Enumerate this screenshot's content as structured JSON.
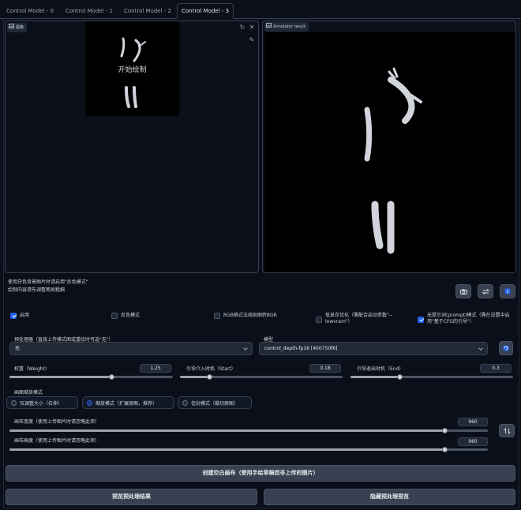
{
  "tabs": [
    {
      "label": "Control Model - 0"
    },
    {
      "label": "Control Model - 1"
    },
    {
      "label": "Control Model - 2"
    },
    {
      "label": "Control Model - 3"
    }
  ],
  "image_panel": {
    "label": "图像",
    "canvas_hint": "开始绘制"
  },
  "annotator": {
    "label": "Annotator result"
  },
  "notes": {
    "line1": "使用白色背景图片时请启用\"反色模式\"",
    "line2": "绘制内容请先调整笔刷粗细"
  },
  "checkboxes": {
    "enable": {
      "label": "启用",
      "checked": true
    },
    "invert": {
      "label": "反色模式",
      "checked": false
    },
    "rgb_bgr": {
      "label": "RGB格式法线贴图转BGR",
      "checked": false
    },
    "lowvram": {
      "label": "低显存优化（需配合启动参数\"--lowvram\"）",
      "checked": false
    },
    "guess_mode": {
      "label": "无提示词(prompt)模式（需在设置中启用\"基于CFG的引导\"）",
      "checked": true
    }
  },
  "preprocessor": {
    "label": "预处理器（直接上传模式图或重绘时可选\"无\"）",
    "value": "无"
  },
  "model": {
    "label": "模型",
    "value": "control_depth-fp16 [400750f6]"
  },
  "sliders": {
    "weight": {
      "label": "权重（Weight）",
      "value": "1.25",
      "fraction": 0.625
    },
    "start": {
      "label": "引导介入时机（Start）",
      "value": "0.18",
      "fraction": 0.18
    },
    "end": {
      "label": "引导退出时机（End）",
      "value": "0.3",
      "fraction": 0.3
    },
    "canvas_width": {
      "label": "画布宽度（使用上传图片时请忽略此项）",
      "value": "960",
      "fraction": 0.91
    },
    "canvas_height": {
      "label": "画布高度（使用上传图片时请忽略此项）",
      "value": "960",
      "fraction": 0.91
    }
  },
  "resize_mode": {
    "label": "画面缩放模式",
    "options": [
      {
        "label": "仅调整大小（拉伸）",
        "selected": false
      },
      {
        "label": "缩放模式（扩展原图，推荐）",
        "selected": true
      },
      {
        "label": "信封模式（裁切原图）",
        "selected": false
      }
    ]
  },
  "buttons": {
    "create_canvas": "创建空白画布（使用手绘草稿而非上传的图片）",
    "preview": "预览预处理结果",
    "hide_preview": "隐藏预处理预览"
  },
  "icons": {
    "camera": "camera-icon",
    "swap": "swap-icon",
    "info": "info-icon",
    "run": "run-icon",
    "swap_size": "swap-size-icon"
  },
  "colors": {
    "accent": "#2563eb",
    "background": "#0b0f19"
  }
}
